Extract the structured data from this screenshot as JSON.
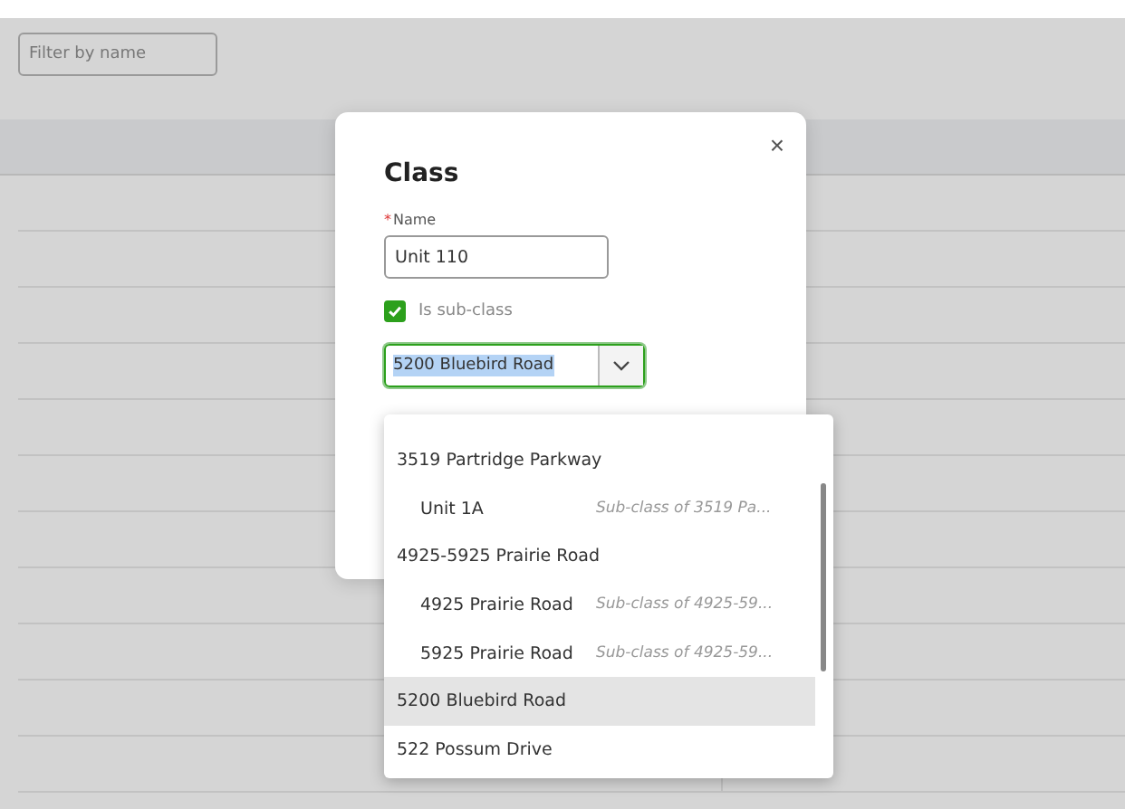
{
  "filter": {
    "placeholder": "Filter by name"
  },
  "dialog": {
    "title": "Class",
    "close": "×",
    "name_label": "Name",
    "required_mark": "*",
    "name_value": "Unit 110",
    "subclass": {
      "label": "Is sub-class",
      "checked": true
    },
    "parent_select": {
      "value": "5200 Bluebird Road",
      "text_selected": true
    }
  },
  "dropdown": {
    "options": [
      {
        "label": "3519 Partridge Parkway",
        "selected": false,
        "children": [
          {
            "label": "Unit 1A",
            "hint": "Sub-class of 3519 Pa...",
            "selected": false
          }
        ]
      },
      {
        "label": "4925-5925 Prairie Road",
        "selected": false,
        "children": [
          {
            "label": "4925 Prairie Road",
            "hint": "Sub-class of 4925-59...",
            "selected": false
          },
          {
            "label": "5925 Prairie Road",
            "hint": "Sub-class of 4925-59...",
            "selected": false
          }
        ]
      },
      {
        "label": "5200 Bluebird Road",
        "selected": true
      },
      {
        "label": "522 Possum Drive",
        "selected": false
      }
    ]
  }
}
